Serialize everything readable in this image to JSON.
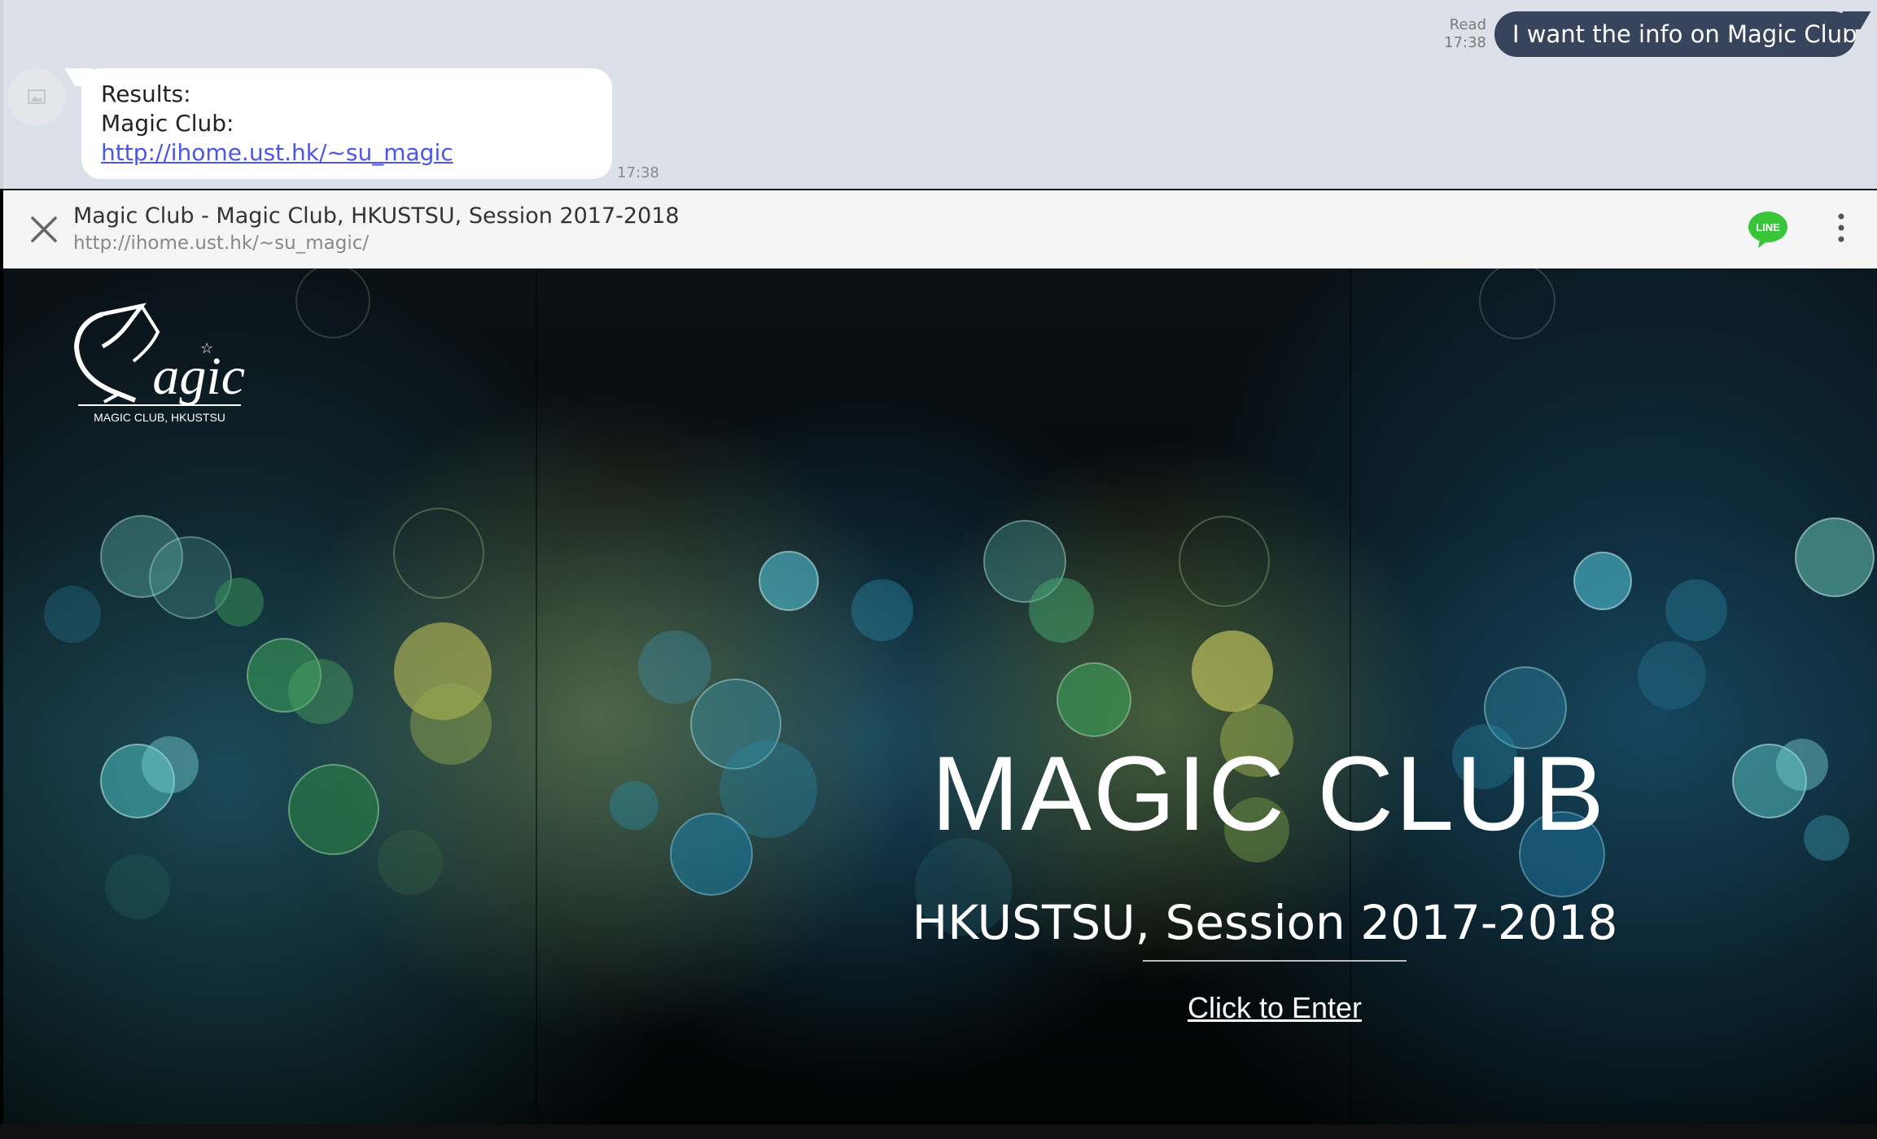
{
  "chat": {
    "incoming": {
      "line1": "Results:",
      "link_label": "Magic Club: ",
      "link_text": "http://ihome.ust.hk/~su_magic",
      "time": "17:38"
    },
    "outgoing": {
      "read_label": "Read",
      "time": "17:38",
      "text": "I want the info on Magic Club"
    }
  },
  "browser": {
    "title": "Magic Club - Magic Club, HKUSTSU, Session 2017-2018",
    "url": "http://ihome.ust.hk/~su_magic/",
    "line_icon_text": "LINE",
    "icons": [
      "close-icon",
      "line-app-icon",
      "more-options-icon"
    ]
  },
  "site": {
    "logo_text": "agic",
    "logo_subtext": "MAGIC CLUB, HKUSTSU",
    "hero_title": "MAGIC CLUB",
    "hero_subtitle": "HKUSTSU, Session 2017-2018",
    "enter_label": "Click to Enter"
  },
  "colors": {
    "chat_bg": "#dce0e8",
    "outgoing_bubble": "#37445c",
    "link": "#4a56e8",
    "line_green": "#3ac43a"
  }
}
